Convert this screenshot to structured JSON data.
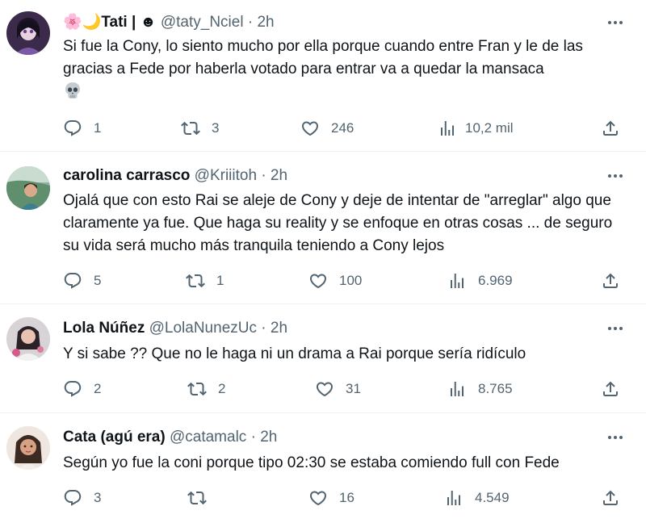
{
  "tweets": [
    {
      "name": "🌸🌙Tati | ☻",
      "handle": "@taty_Nciel",
      "separator": "·",
      "time": "2h",
      "text": "Si fue la Cony, lo siento mucho por ella porque cuando entre Fran y le de las gracias a Fede por haberla votado para entrar va a quedar la mansaca",
      "emoji": "skull-emoji",
      "replies": "1",
      "retweets": "3",
      "likes": "246",
      "views": "10,2 mil"
    },
    {
      "name": "carolina carrasco",
      "handle": "@Kriiitoh",
      "separator": "·",
      "time": "2h",
      "text": "Ojalá que con esto Rai se aleje de Cony y deje de intentar de \"arreglar\" algo que claramente ya fue. Que haga su reality y se enfoque en otras cosas ... de seguro su vida será mucho más tranquila teniendo a Cony lejos",
      "replies": "5",
      "retweets": "1",
      "likes": "100",
      "views": "6.969"
    },
    {
      "name": "Lola Núñez",
      "handle": "@LolaNunezUc",
      "separator": "·",
      "time": "2h",
      "text": "Y si sabe ?? Que no le haga ni un drama a Rai porque sería ridículo",
      "replies": "2",
      "retweets": "2",
      "likes": "31",
      "views": "8.765"
    },
    {
      "name": "Cata (agú era)",
      "handle": "@catamalc",
      "separator": "·",
      "time": "2h",
      "text": "Según yo fue la coni porque tipo 02:30 se estaba comiendo full con Fede",
      "replies": "3",
      "retweets": "",
      "likes": "16",
      "views": "4.549"
    }
  ],
  "colors": {
    "text": "#0f1419",
    "secondary": "#536471",
    "divider": "#eff3f4"
  }
}
